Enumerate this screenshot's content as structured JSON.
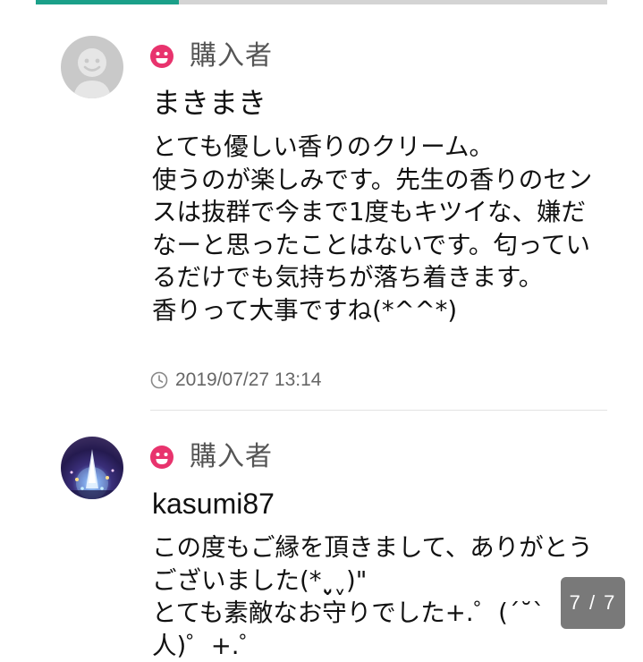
{
  "colors": {
    "accent_teal": "#1ba089",
    "badge_pink": "#e8336d",
    "text_primary": "#111111",
    "text_secondary": "#666666"
  },
  "reviews": [
    {
      "badge_icon": "smiley-icon",
      "badge_label": "購入者",
      "username": "まきまき",
      "body": "とても優しい香りのクリーム。\n使うのが楽しみです。先生の香りのセンスは抜群で今まで1度もキツイな、嫌だなーと思ったことはないです。匂っているだけでも気持ちが落ち着きます。\n香りって大事ですね(*^^*)",
      "timestamp": "2019/07/27 13:14"
    },
    {
      "badge_icon": "smiley-icon",
      "badge_label": "購入者",
      "username": "kasumi87",
      "body": "この度もご縁を頂きまして、ありがとうございました(*ˬ̮ˬ)\"\nとても素敵なお守りでした+.゜(´˘`\n人)゜+.゜"
    }
  ],
  "page_indicator": "7 / 7"
}
